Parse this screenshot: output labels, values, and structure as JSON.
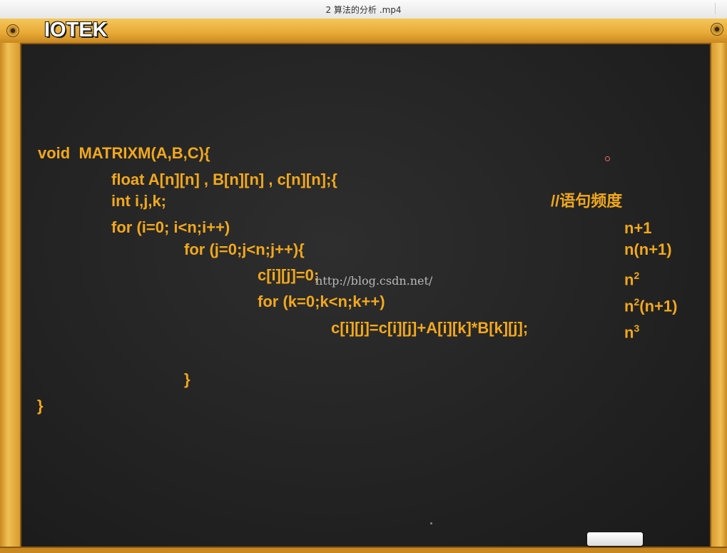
{
  "window": {
    "title": "2  算法的分析 .mp4"
  },
  "logo": "IOTEK",
  "code": {
    "line1": "void  MATRIXM(A,B,C){",
    "line2": "float A[n][n] , B[n][n] , c[n][n];{",
    "line3": "int i,j,k;",
    "comment": "//语句频度",
    "line4": "for (i=0; i<n;i++)",
    "line5": "for (j=0;j<n;j++){",
    "line6": "c[i][j]=0;",
    "line7": "for (k=0;k<n;k++)",
    "line8": "c[i][j]=c[i][j]+A[i][k]*B[k][j];",
    "close_inner": "}",
    "close_outer": "}"
  },
  "frequencies": {
    "f1": "n+1",
    "f2": "n(n+1)",
    "f3_base": "n",
    "f3_exp": "2",
    "f4_base": "n",
    "f4_exp": "2",
    "f4_tail": "(n+1)",
    "f5_base": "n",
    "f5_exp": "3"
  },
  "watermark": "http://blog.csdn.net/"
}
